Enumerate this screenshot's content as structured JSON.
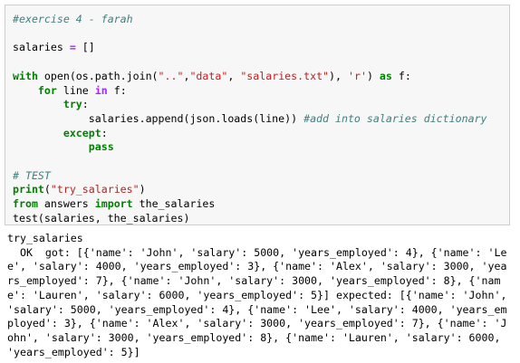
{
  "cell": {
    "lines": [
      [
        {
          "t": "#exercise 4 - farah",
          "c": "cm"
        }
      ],
      [
        {
          "t": "",
          "c": "nm"
        }
      ],
      [
        {
          "t": "salaries ",
          "c": "nm"
        },
        {
          "t": "=",
          "c": "op"
        },
        {
          "t": " []",
          "c": "nm"
        }
      ],
      [
        {
          "t": "",
          "c": "nm"
        }
      ],
      [
        {
          "t": "with",
          "c": "kw"
        },
        {
          "t": " open(os.path.join(",
          "c": "nm"
        },
        {
          "t": "\"..\"",
          "c": "st"
        },
        {
          "t": ",",
          "c": "nm"
        },
        {
          "t": "\"data\"",
          "c": "st"
        },
        {
          "t": ", ",
          "c": "nm"
        },
        {
          "t": "\"salaries.txt\"",
          "c": "st"
        },
        {
          "t": "), ",
          "c": "nm"
        },
        {
          "t": "'r'",
          "c": "st"
        },
        {
          "t": ") ",
          "c": "nm"
        },
        {
          "t": "as",
          "c": "kw"
        },
        {
          "t": " f:",
          "c": "nm"
        }
      ],
      [
        {
          "t": "    ",
          "c": "nm"
        },
        {
          "t": "for",
          "c": "kw"
        },
        {
          "t": " line ",
          "c": "nm"
        },
        {
          "t": "in",
          "c": "op"
        },
        {
          "t": " f:",
          "c": "nm"
        }
      ],
      [
        {
          "t": "        ",
          "c": "nm"
        },
        {
          "t": "try",
          "c": "kw"
        },
        {
          "t": ":",
          "c": "nm"
        }
      ],
      [
        {
          "t": "            salaries.append(json.loads(line)) ",
          "c": "nm"
        },
        {
          "t": "#add into salaries dictionary",
          "c": "cm"
        }
      ],
      [
        {
          "t": "        ",
          "c": "nm"
        },
        {
          "t": "except",
          "c": "kw"
        },
        {
          "t": ":",
          "c": "nm"
        }
      ],
      [
        {
          "t": "            ",
          "c": "nm"
        },
        {
          "t": "pass",
          "c": "kw"
        }
      ],
      [
        {
          "t": "",
          "c": "nm"
        }
      ],
      [
        {
          "t": "# TEST",
          "c": "cm"
        }
      ],
      [
        {
          "t": "print",
          "c": "kw"
        },
        {
          "t": "(",
          "c": "nm"
        },
        {
          "t": "\"try_salaries\"",
          "c": "st"
        },
        {
          "t": ")",
          "c": "nm"
        }
      ],
      [
        {
          "t": "from",
          "c": "kw"
        },
        {
          "t": " answers ",
          "c": "nm"
        },
        {
          "t": "import",
          "c": "kw"
        },
        {
          "t": " the_salaries",
          "c": "nm"
        }
      ],
      [
        {
          "t": "test(salaries, the_salaries)",
          "c": "nm"
        }
      ]
    ]
  },
  "output": {
    "lines": [
      "try_salaries",
      "  OK  got: [{'name': 'John', 'salary': 5000, 'years_employed': 4}, {'name': 'Le",
      "e', 'salary': 4000, 'years_employed': 3}, {'name': 'Alex', 'salary': 3000, 'yea",
      "rs_employed': 7}, {'name': 'John', 'salary': 3000, 'years_employed': 8}, {'nam",
      "e': 'Lauren', 'salary': 6000, 'years_employed': 5}] expected: [{'name': 'John',",
      "'salary': 5000, 'years_employed': 4}, {'name': 'Lee', 'salary': 4000, 'years_em",
      "ployed': 3}, {'name': 'Alex', 'salary': 3000, 'years_employed': 7}, {'name': 'J",
      "ohn', 'salary': 3000, 'years_employed': 8}, {'name': 'Lauren', 'salary': 6000,",
      "'years_employed': 5}]"
    ]
  }
}
